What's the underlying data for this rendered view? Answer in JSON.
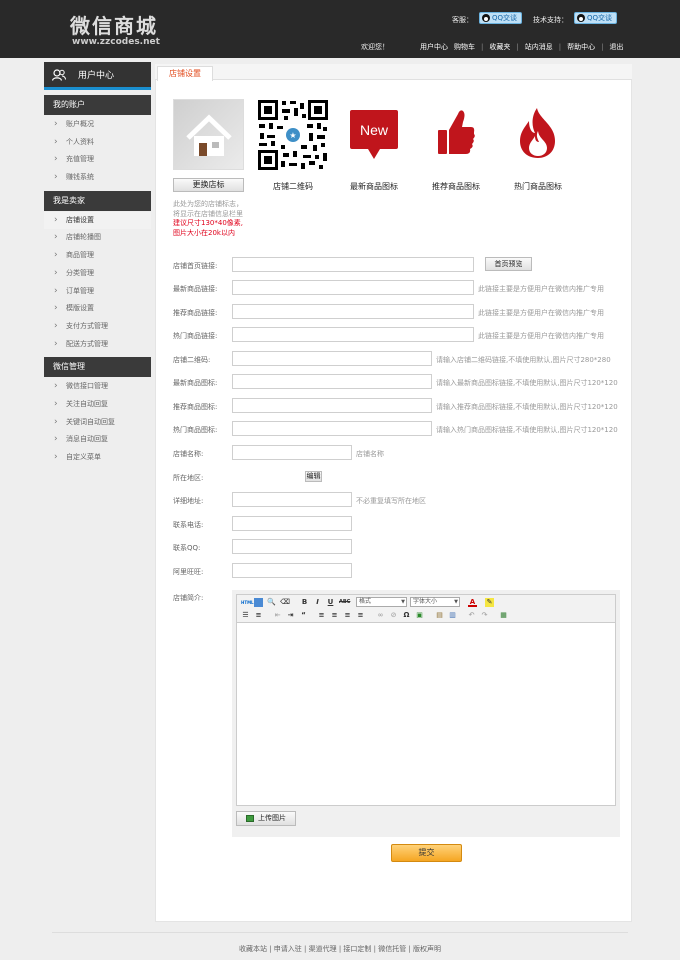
{
  "header": {
    "logo_text": "微信商城",
    "logo_url": "www.zzcodes.net",
    "service_label": "客服：",
    "tech_label": "技术支持：",
    "qq_label": "QQ交谈",
    "welcome": "欢迎您！",
    "nav": [
      "用户中心",
      "购物车",
      "收藏夹",
      "站内消息",
      "帮助中心",
      "退出"
    ]
  },
  "sidebar": {
    "title": "用户中心",
    "sections": [
      {
        "title": "我的账户",
        "items": [
          "账户概况",
          "个人资料",
          "充值管理",
          "赚钱系统"
        ]
      },
      {
        "title": "我是卖家",
        "items": [
          "店铺设置",
          "店铺轮播图",
          "商品管理",
          "分类管理",
          "订单管理",
          "模版设置",
          "支付方式管理",
          "配送方式管理"
        ]
      },
      {
        "title": "微信管理",
        "items": [
          "微信接口管理",
          "关注自动回复",
          "关键词自动回复",
          "消息自动回复",
          "自定义菜单"
        ]
      }
    ],
    "active_item": "店铺设置"
  },
  "tab": {
    "label": "店铺设置"
  },
  "icons": {
    "change_logo_btn": "更换店标",
    "qr_label": "店铺二维码",
    "new_icon_text": "New",
    "new_label": "最新商品图标",
    "recommend_label": "推荐商品图标",
    "hot_label": "热门商品图标",
    "logo_hint_1": "此处为您的店铺标志，",
    "logo_hint_2": "将显示在店铺信息栏里",
    "logo_hint_3": "建议尺寸130*40像素,",
    "logo_hint_4": "图片大小在20k以内"
  },
  "form": {
    "home_link_label": "店铺首页链接:",
    "preview_btn": "首页预览",
    "new_link_label": "最新商品链接:",
    "rec_link_label": "推荐商品链接:",
    "hot_link_label": "热门商品链接:",
    "link_hint": "此链接主要是方便用户在微信内推广专用",
    "qr_label": "店铺二维码:",
    "qr_hint": "请输入店铺二维码链接,不填使用默认,图片尺寸280*280",
    "new_icon_label": "最新商品图标:",
    "new_icon_hint": "请输入最新商品图标链接,不填使用默认,图片尺寸120*120",
    "rec_icon_label": "推荐商品图标:",
    "rec_icon_hint": "请输入推荐商品图标链接,不填使用默认,图片尺寸120*120",
    "hot_icon_label": "热门商品图标:",
    "hot_icon_hint": "请输入热门商品图标链接,不填使用默认,图片尺寸120*120",
    "name_label": "店铺名称:",
    "name_hint": "店铺名称",
    "region_label": "所在地区:",
    "edit_btn": "编辑",
    "address_label": "详细地址:",
    "address_hint": "不必重复填写所在地区",
    "phone_label": "联系电话:",
    "qq_label": "联系QQ:",
    "ww_label": "阿里旺旺:",
    "intro_label": "店铺简介:",
    "editor_format": "格式",
    "editor_fontsize": "字体大小",
    "upload_btn": "上传图片",
    "submit_btn": "提交"
  },
  "footer": {
    "links": [
      "收藏本站",
      "申请入驻",
      "渠道代理",
      "接口定制",
      "微信托管",
      "版权声明"
    ]
  },
  "colors": {
    "accent": "#1a8fd0",
    "red_icon": "#c0151c",
    "hint_red": "#e0001b"
  }
}
